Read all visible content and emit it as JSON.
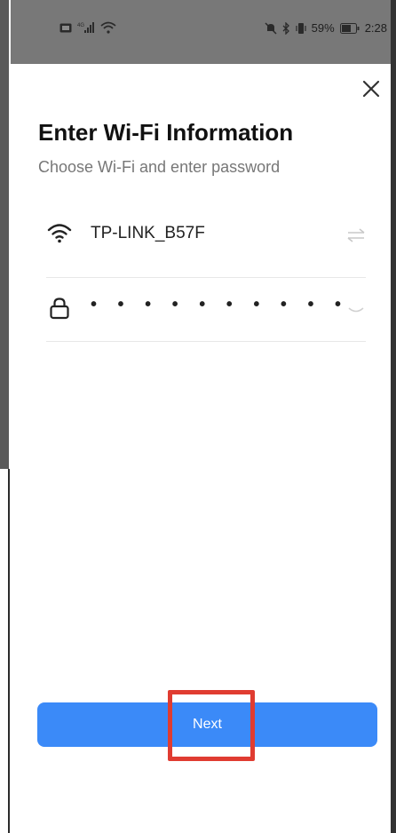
{
  "status_bar": {
    "battery_percent": "59%",
    "time": "2:28"
  },
  "dialog": {
    "title": "Enter Wi-Fi Information",
    "subtitle": "Choose Wi-Fi and enter password"
  },
  "wifi": {
    "ssid": "TP-LINK_B57F"
  },
  "password": {
    "masked_value": "• • • • • • • • • •"
  },
  "actions": {
    "next_label": "Next"
  },
  "colors": {
    "primary": "#3b8af8",
    "highlight": "#e03c31",
    "status_bar_bg": "#787878"
  }
}
